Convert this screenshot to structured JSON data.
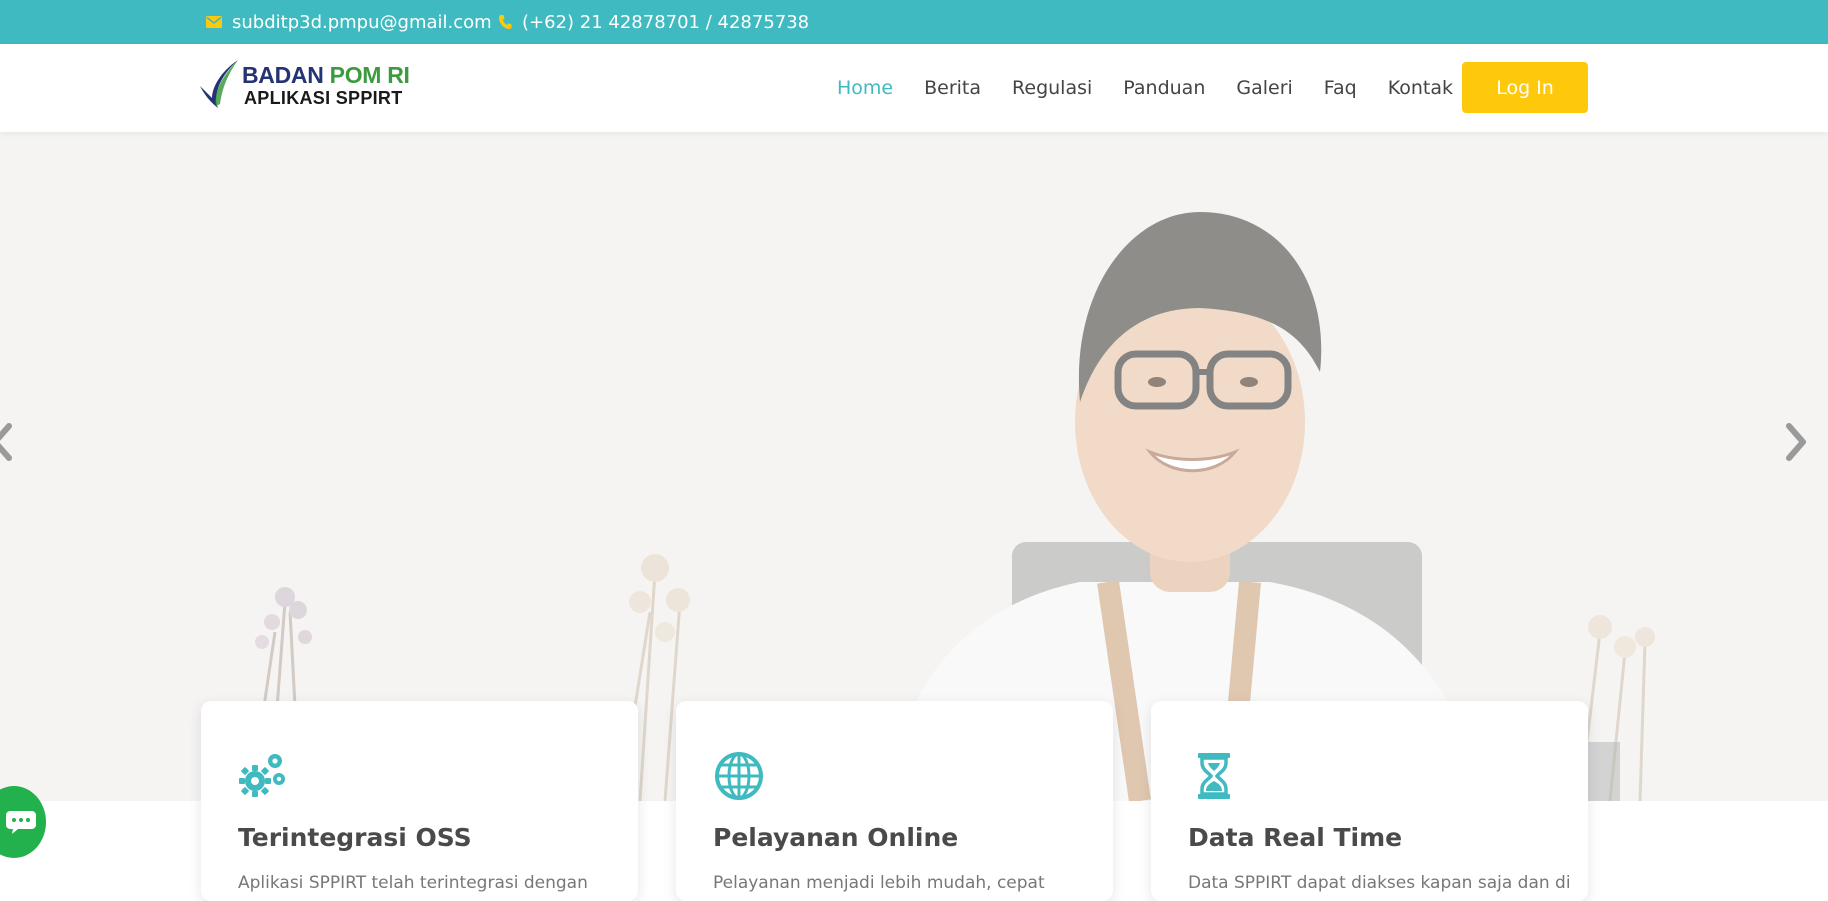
{
  "topbar": {
    "email": "subditp3d.pmpu@gmail.com",
    "phone": "(+62) 21 42878701 / 42875738",
    "icon_color": "#ffc90b",
    "bg_color": "#3fbac0"
  },
  "logo": {
    "line1_a": "BADAN",
    "line1_b": "POM RI",
    "line2": "APLIKASI SPPIRT"
  },
  "nav": {
    "items": [
      "Home",
      "Berita",
      "Regulasi",
      "Panduan",
      "Galeri",
      "Faq",
      "Kontak"
    ],
    "active": "Home",
    "login_label": "Log In"
  },
  "hero": {
    "prev_icon": "chevron-left-icon",
    "next_icon": "chevron-right-icon"
  },
  "cards": [
    {
      "icon": "gears-icon",
      "title": "Terintegrasi OSS",
      "desc": "Aplikasi SPPIRT telah terintegrasi dengan"
    },
    {
      "icon": "globe-icon",
      "title": "Pelayanan Online",
      "desc": "Pelayanan menjadi lebih mudah, cepat"
    },
    {
      "icon": "hourglass-icon",
      "title": "Data Real Time",
      "desc": "Data SPPIRT dapat diakses kapan saja dan di"
    }
  ],
  "colors": {
    "accent": "#3fbac0",
    "login_button": "#ffc90b",
    "chat": "#22b14c"
  }
}
